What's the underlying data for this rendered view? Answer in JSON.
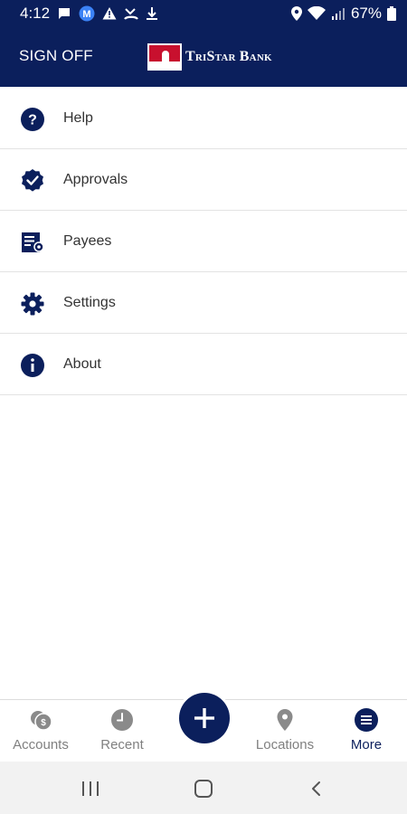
{
  "status_bar": {
    "time": "4:12",
    "battery_percent": "67%",
    "left_icons": [
      "message-icon",
      "m-app-icon",
      "warning-icon",
      "missed-call-icon",
      "download-icon"
    ],
    "right_icons": [
      "location-icon",
      "wifi-icon",
      "signal-icon",
      "battery-icon"
    ]
  },
  "header": {
    "signoff_label": "SIGN OFF",
    "logo_text": "TriStar Bank"
  },
  "menu": {
    "items": [
      {
        "label": "Help",
        "icon": "help-icon"
      },
      {
        "label": "Approvals",
        "icon": "approvals-badge-icon"
      },
      {
        "label": "Payees",
        "icon": "payees-icon"
      },
      {
        "label": "Settings",
        "icon": "gear-icon"
      },
      {
        "label": "About",
        "icon": "info-icon"
      }
    ]
  },
  "tabs": {
    "items": [
      {
        "label": "Accounts",
        "icon": "accounts-icon",
        "active": false
      },
      {
        "label": "Recent",
        "icon": "clock-icon",
        "active": false
      },
      {
        "label": "Locations",
        "icon": "location-pin-icon",
        "active": false
      },
      {
        "label": "More",
        "icon": "menu-icon",
        "active": true
      }
    ],
    "fab_icon": "plus-icon"
  },
  "colors": {
    "primary": "#0b1f5c",
    "logo_red": "#c8102e",
    "inactive_tab": "#808080",
    "label_text": "#333333",
    "divider": "#e3e3e3"
  }
}
